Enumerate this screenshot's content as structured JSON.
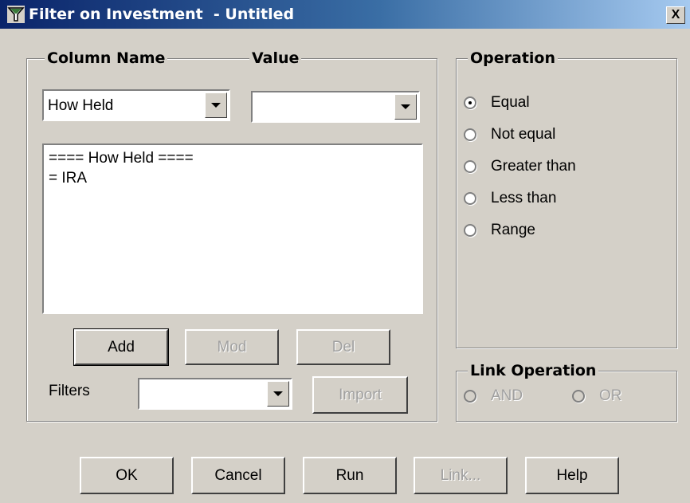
{
  "window": {
    "title": "Filter on Investment  - Untitled",
    "close_label": "X"
  },
  "filter_group": {
    "column_name_label": "Column Name",
    "value_label": "Value",
    "column_select_value": "How Held",
    "value_select_value": "",
    "criteria_lines": [
      "==== How Held ====",
      "= IRA"
    ],
    "add_label": "Add",
    "mod_label": "Mod",
    "del_label": "Del",
    "filters_label": "Filters",
    "filters_select_value": "",
    "import_label": "Import"
  },
  "operation": {
    "legend": "Operation",
    "options": [
      {
        "label": "Equal",
        "checked": true
      },
      {
        "label": "Not equal",
        "checked": false
      },
      {
        "label": "Greater than",
        "checked": false
      },
      {
        "label": "Less than",
        "checked": false
      },
      {
        "label": "Range",
        "checked": false
      }
    ]
  },
  "link_operation": {
    "legend": "Link Operation",
    "and_label": "AND",
    "or_label": "OR"
  },
  "footer": {
    "ok_label": "OK",
    "cancel_label": "Cancel",
    "run_label": "Run",
    "link_label": "Link...",
    "help_label": "Help"
  }
}
